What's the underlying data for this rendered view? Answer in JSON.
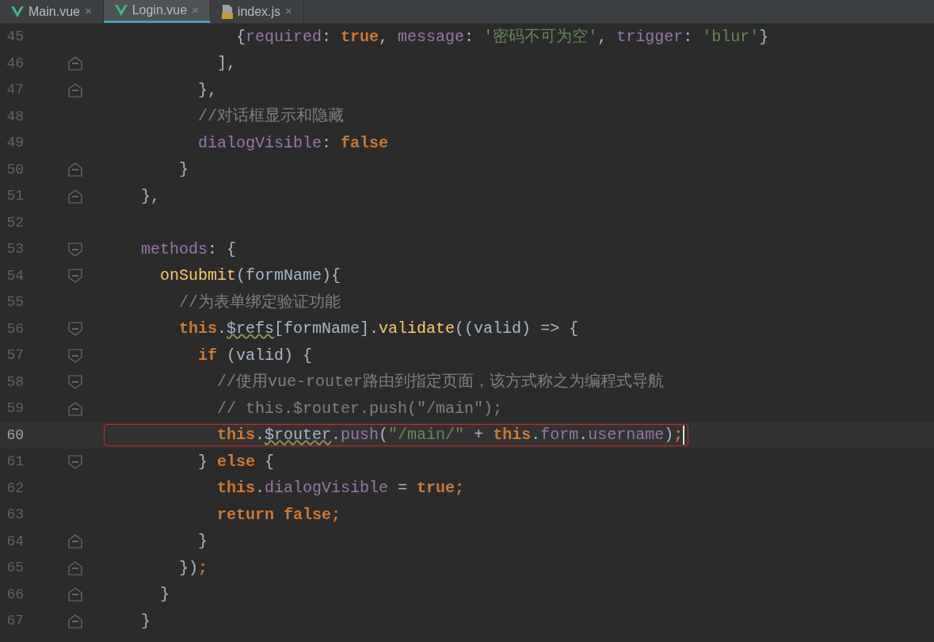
{
  "tabs": [
    {
      "label": "Main.vue",
      "kind": "vue",
      "close": "×",
      "selected": false
    },
    {
      "label": "Login.vue",
      "kind": "vue",
      "close": "×",
      "selected": true
    },
    {
      "label": "index.js",
      "kind": "js",
      "close": "×",
      "selected": false
    }
  ],
  "lines": [
    {
      "number": "45",
      "kind": "plain",
      "current": false,
      "tokens": [
        {
          "kind": "plain",
          "text": "            {"
        },
        {
          "kind": "prop",
          "text": "required"
        },
        {
          "kind": "plain",
          "text": ": "
        },
        {
          "kind": "kw",
          "text": "true"
        },
        {
          "kind": "plain",
          "text": ", "
        },
        {
          "kind": "prop",
          "text": "message"
        },
        {
          "kind": "plain",
          "text": ": "
        },
        {
          "kind": "str",
          "text": "'密码不可为空'"
        },
        {
          "kind": "plain",
          "text": ", "
        },
        {
          "kind": "prop",
          "text": "trigger"
        },
        {
          "kind": "plain",
          "text": ": "
        },
        {
          "kind": "str",
          "text": "'blur'"
        },
        {
          "kind": "plain",
          "text": "}"
        }
      ]
    },
    {
      "number": "46",
      "kind": "closer",
      "current": false,
      "tokens": [
        {
          "kind": "plain",
          "text": "          ],"
        }
      ]
    },
    {
      "number": "47",
      "kind": "closer",
      "current": false,
      "tokens": [
        {
          "kind": "plain",
          "text": "        },"
        }
      ]
    },
    {
      "number": "48",
      "kind": "plain",
      "current": false,
      "tokens": [
        {
          "kind": "comment",
          "text": "        //对话框显示和隐藏"
        }
      ]
    },
    {
      "number": "49",
      "kind": "plain",
      "current": false,
      "tokens": [
        {
          "kind": "prop",
          "text": "        dialogVisible"
        },
        {
          "kind": "plain",
          "text": ": "
        },
        {
          "kind": "kw",
          "text": "false"
        }
      ]
    },
    {
      "number": "50",
      "kind": "closer",
      "current": false,
      "tokens": [
        {
          "kind": "plain",
          "text": "      }"
        }
      ]
    },
    {
      "number": "51",
      "kind": "closer",
      "current": false,
      "tokens": [
        {
          "kind": "plain",
          "text": "  },"
        }
      ]
    },
    {
      "number": "52",
      "kind": "plain",
      "current": false
    },
    {
      "number": "53",
      "kind": "opener",
      "current": false,
      "tokens": [
        {
          "kind": "prop",
          "text": "  methods"
        },
        {
          "kind": "plain",
          "text": ": {"
        }
      ]
    },
    {
      "number": "54",
      "kind": "opener",
      "current": false,
      "tokens": [
        {
          "kind": "fn",
          "text": "    onSubmit"
        },
        {
          "kind": "plain",
          "text": "(formName){"
        }
      ]
    },
    {
      "number": "55",
      "kind": "plain",
      "current": false,
      "tokens": [
        {
          "kind": "comment",
          "text": "      //为表单绑定验证功能"
        }
      ]
    },
    {
      "number": "56",
      "kind": "opener",
      "current": false,
      "tokens": [
        {
          "kind": "kw",
          "text": "      this"
        },
        {
          "kind": "plain",
          "text": "."
        },
        {
          "kind": "plainwavy",
          "text": "$refs"
        },
        {
          "kind": "plain",
          "text": "[formName]."
        },
        {
          "kind": "fn",
          "text": "validate"
        },
        {
          "kind": "plain",
          "text": "((valid) => {"
        }
      ]
    },
    {
      "number": "57",
      "kind": "opener",
      "current": false,
      "tokens": [
        {
          "kind": "kw",
          "text": "        if"
        },
        {
          "kind": "plain",
          "text": " (valid) {"
        }
      ]
    },
    {
      "number": "58",
      "kind": "opener",
      "current": false,
      "tokens": [
        {
          "kind": "comment",
          "text": "          //使用vue-router路由到指定页面，该方式称之为编程式导航"
        }
      ]
    },
    {
      "number": "59",
      "kind": "closer",
      "current": false,
      "tokens": [
        {
          "kind": "comment",
          "text": "          // this.$router.push(\"/main\");"
        }
      ]
    },
    {
      "number": "60",
      "kind": "plain",
      "current": true,
      "tokens": [
        {
          "kind": "kw",
          "text": "          this"
        },
        {
          "kind": "plain",
          "text": "."
        },
        {
          "kind": "plainwavy",
          "text": "$router"
        },
        {
          "kind": "plain",
          "text": "."
        },
        {
          "kind": "prop",
          "text": "push"
        },
        {
          "kind": "plain",
          "text": "("
        },
        {
          "kind": "str",
          "text": "\"/main/\""
        },
        {
          "kind": "plain",
          "text": " + "
        },
        {
          "kind": "kw",
          "text": "this"
        },
        {
          "kind": "plain",
          "text": "."
        },
        {
          "kind": "prop",
          "text": "form"
        },
        {
          "kind": "plain",
          "text": "."
        },
        {
          "kind": "prop",
          "text": "username"
        },
        {
          "kind": "plain",
          "text": ")"
        },
        {
          "kind": "kw",
          "text": ";"
        }
      ]
    },
    {
      "number": "61",
      "kind": "opener",
      "current": false,
      "tokens": [
        {
          "kind": "plain",
          "text": "        } "
        },
        {
          "kind": "kw",
          "text": "else"
        },
        {
          "kind": "plain",
          "text": " {"
        }
      ]
    },
    {
      "number": "62",
      "kind": "plain",
      "current": false,
      "tokens": [
        {
          "kind": "kw",
          "text": "          this"
        },
        {
          "kind": "plain",
          "text": "."
        },
        {
          "kind": "prop",
          "text": "dialogVisible"
        },
        {
          "kind": "plain",
          "text": " = "
        },
        {
          "kind": "kw",
          "text": "true;"
        }
      ]
    },
    {
      "number": "63",
      "kind": "plain",
      "current": false,
      "tokens": [
        {
          "kind": "kw",
          "text": "          return false;"
        }
      ]
    },
    {
      "number": "64",
      "kind": "closer",
      "current": false,
      "tokens": [
        {
          "kind": "plain",
          "text": "        }"
        }
      ]
    },
    {
      "number": "65",
      "kind": "closer",
      "current": false,
      "tokens": [
        {
          "kind": "plain",
          "text": "      })"
        },
        {
          "kind": "kw",
          "text": ";"
        }
      ]
    },
    {
      "number": "66",
      "kind": "closer",
      "current": false,
      "tokens": [
        {
          "kind": "plain",
          "text": "    }"
        }
      ]
    },
    {
      "number": "67",
      "kind": "closer",
      "current": false,
      "tokens": [
        {
          "kind": "plain",
          "text": "  }"
        }
      ]
    }
  ]
}
